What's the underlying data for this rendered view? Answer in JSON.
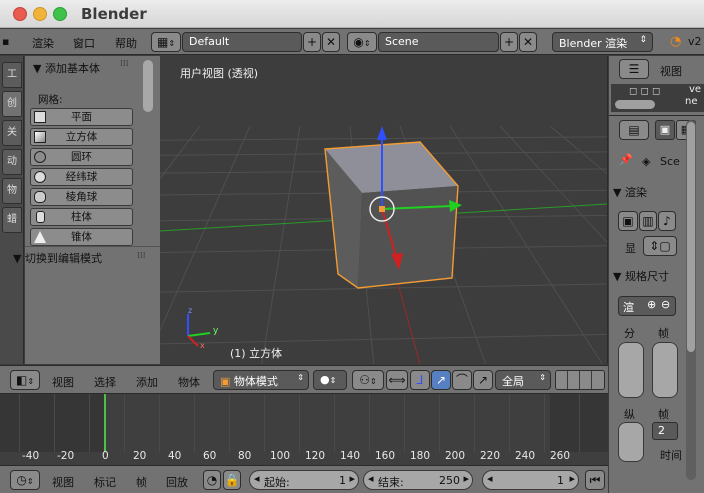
{
  "window": {
    "title": "Blender"
  },
  "colors": {
    "close": "#e85b4d",
    "minimize": "#f0b43a",
    "maximize": "#3fc14a",
    "selection": "#f39c33",
    "x_axis": "#d02020",
    "y_axis": "#20d020",
    "z_axis": "#3050ff",
    "playhead": "#4ec046"
  },
  "info_header": {
    "menus": [
      "渲染",
      "窗口",
      "帮助"
    ],
    "layout_value": "Default",
    "scene_value": "Scene",
    "engine_value": "Blender 渲染"
  },
  "tool_shelf": {
    "tabs": [
      "工",
      "创",
      "关",
      "动",
      "物",
      "蜡"
    ],
    "panel_add_title": "▼ 添加基本体",
    "mesh_label": "网格:",
    "buttons": [
      "平面",
      "立方体",
      "圆环",
      "经纬球",
      "棱角球",
      "柱体",
      "锥体"
    ],
    "panel_edit_title": "▼ 切换到编辑模式"
  },
  "viewport": {
    "label": "用户视图 (透视)",
    "object_label": "(1) 立方体",
    "axis_labels": {
      "x": "x",
      "y": "y",
      "z": "z"
    }
  },
  "view3d_header": {
    "menus": [
      "视图",
      "选择",
      "添加",
      "物体"
    ],
    "mode": "物体模式",
    "orientation": "全局"
  },
  "timeline": {
    "ticks": [
      "-40",
      "-20",
      "0",
      "20",
      "40",
      "60",
      "80",
      "100",
      "120",
      "140",
      "160",
      "180",
      "200",
      "220",
      "240",
      "260"
    ],
    "current_frame": 1,
    "header_menus": [
      "视图",
      "标记",
      "帧",
      "回放"
    ],
    "start_label": "起始:",
    "start_value": "1",
    "end_label": "结束:",
    "end_value": "250",
    "frame_value": "1"
  },
  "right_panel": {
    "outliner_view": "视图",
    "outliner_text": "ne",
    "outliner_text2": "ve",
    "scene_text": "Sce",
    "render_title": "▼ 渲染",
    "display_label": "显",
    "size_title": "▼ 规格尺寸",
    "preset_label": "渲",
    "res_label": "分",
    "frame_label": "帧",
    "aspect_label": "纵",
    "frame2_label": "帧",
    "frame_num": "2",
    "time_label": "时间"
  }
}
